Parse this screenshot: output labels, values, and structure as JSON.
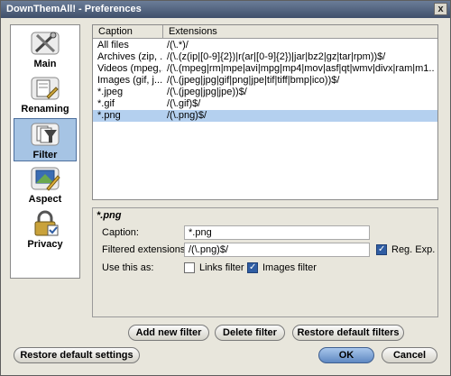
{
  "window": {
    "title": "DownThemAll! - Preferences",
    "close_glyph": "x"
  },
  "sidebar": {
    "items": [
      {
        "label": "Main",
        "icon": "tools-icon"
      },
      {
        "label": "Renaming",
        "icon": "rename-icon"
      },
      {
        "label": "Filter",
        "icon": "filter-icon",
        "selected": true
      },
      {
        "label": "Aspect",
        "icon": "aspect-icon"
      },
      {
        "label": "Privacy",
        "icon": "lock-icon"
      }
    ]
  },
  "filters": {
    "headers": {
      "caption": "Caption",
      "extensions": "Extensions"
    },
    "rows": [
      {
        "caption": "All files",
        "extensions": "/(\\.*)/"
      },
      {
        "caption": "Archives (zip, ...",
        "extensions": "/(\\.(z(ip|[0-9]{2})|r(ar|[0-9]{2})|jar|bz2|gz|tar|rpm))$/"
      },
      {
        "caption": "Videos (mpeg,...",
        "extensions": "/(\\.(mpeg|rm|mpe|avi|mpg|mp4|mov|asf|qt|wmv|divx|ram|m1..."
      },
      {
        "caption": "Images (gif, j...",
        "extensions": "/(\\.(jpeg|jpg|gif|png|jpe|tif|tiff|bmp|ico))$/"
      },
      {
        "caption": "*.jpeg",
        "extensions": "/(\\.(jpeg|jpg|jpe))$/"
      },
      {
        "caption": "*.gif",
        "extensions": "/(\\.gif)$/"
      },
      {
        "caption": "*.png",
        "extensions": "/(\\.png)$/",
        "selected": true
      }
    ]
  },
  "details": {
    "heading": "*.png",
    "caption_label": "Caption:",
    "caption_value": "*.png",
    "extensions_label": "Filtered extensions:",
    "extensions_value": "/(\\.png)$/",
    "regexp_label": "Reg. Exp.",
    "regexp_checked": true,
    "use_as_label": "Use this as:",
    "links_filter_label": "Links filter",
    "links_filter_checked": false,
    "images_filter_label": "Images filter",
    "images_filter_checked": true
  },
  "buttons": {
    "add_filter": "Add new filter",
    "delete_filter": "Delete filter",
    "restore_filters": "Restore default filters",
    "restore_settings": "Restore default settings",
    "ok": "OK",
    "cancel": "Cancel"
  },
  "colors": {
    "titlebar": "#3f4f6a",
    "selection": "#b4d0ef",
    "accent": "#5f88c2"
  }
}
